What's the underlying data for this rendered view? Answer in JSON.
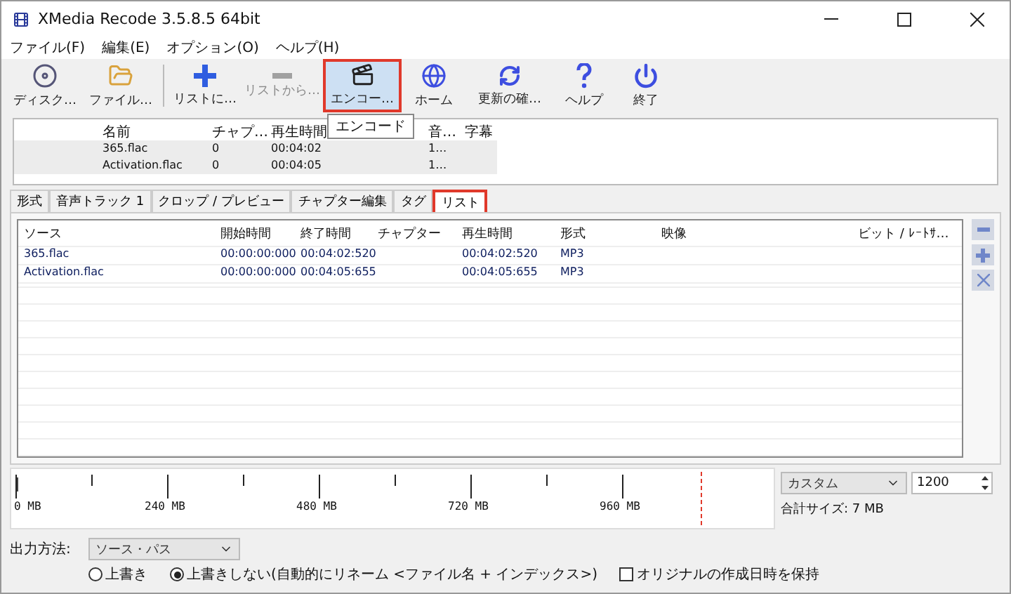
{
  "window": {
    "title": "XMedia Recode 3.5.8.5 64bit"
  },
  "menu": [
    "ファイル(F)",
    "編集(E)",
    "オプション(O)",
    "ヘルプ(H)"
  ],
  "toolbar": [
    {
      "label": "ディスク…",
      "disabled": false,
      "highlighted": false
    },
    {
      "label": "ファイル…",
      "disabled": false,
      "highlighted": false
    },
    {
      "label": "リストに…",
      "disabled": false,
      "highlighted": false
    },
    {
      "label": "リストから…",
      "disabled": true,
      "highlighted": false
    },
    {
      "label": "エンコー…",
      "disabled": false,
      "highlighted": true
    },
    {
      "label": "ホーム",
      "disabled": false,
      "highlighted": false
    },
    {
      "label": "更新の確…",
      "disabled": false,
      "highlighted": false
    },
    {
      "label": "ヘルプ",
      "disabled": false,
      "highlighted": false
    },
    {
      "label": "終了",
      "disabled": false,
      "highlighted": false
    }
  ],
  "tooltip": "エンコード",
  "files": {
    "columns": [
      "名前",
      "チャプ…",
      "再生時間",
      "音…",
      "字幕"
    ],
    "rows": [
      [
        "365.flac",
        "0",
        "00:04:02",
        "1…"
      ],
      [
        "Activation.flac",
        "0",
        "00:04:05",
        "1…"
      ]
    ]
  },
  "tabs": [
    {
      "label": "形式",
      "selected": false,
      "highlighted": false
    },
    {
      "label": "音声トラック 1",
      "selected": false,
      "highlighted": false
    },
    {
      "label": "クロップ / プレビュー",
      "selected": false,
      "highlighted": false
    },
    {
      "label": "チャプター編集",
      "selected": false,
      "highlighted": false
    },
    {
      "label": "タグ",
      "selected": false,
      "highlighted": false
    },
    {
      "label": "リスト",
      "selected": true,
      "highlighted": true
    }
  ],
  "list": {
    "columns": [
      "ソース",
      "開始時間",
      "終了時間",
      "チャプター",
      "再生時間",
      "形式",
      "映像",
      "ビット / ﾚｰﾄｻ…"
    ],
    "rows": [
      [
        "365.flac",
        "00:00:00:000",
        "00:04:02:520",
        "",
        "00:04:02:520",
        "MP3",
        "",
        ""
      ],
      [
        "Activation.flac",
        "00:00:00:000",
        "00:04:05:655",
        "",
        "00:04:05:655",
        "MP3",
        "",
        ""
      ]
    ]
  },
  "size_bar": {
    "ticks": [
      "0 MB",
      "240 MB",
      "480 MB",
      "720 MB",
      "960 MB"
    ],
    "level": 0.005,
    "preset": "カスタム",
    "limit": "1200",
    "total": "合計サイズ: 7 MB"
  },
  "output": {
    "label": "出力方法:",
    "mode": "ソース・パス",
    "options": [
      {
        "label": "上書き",
        "selected": false
      },
      {
        "label": "上書きしない(自動的にリネーム <ファイル名 + インデックス>)",
        "selected": true
      }
    ],
    "keep_date": {
      "label": "オリジナルの作成日時を保持",
      "checked": false
    }
  }
}
